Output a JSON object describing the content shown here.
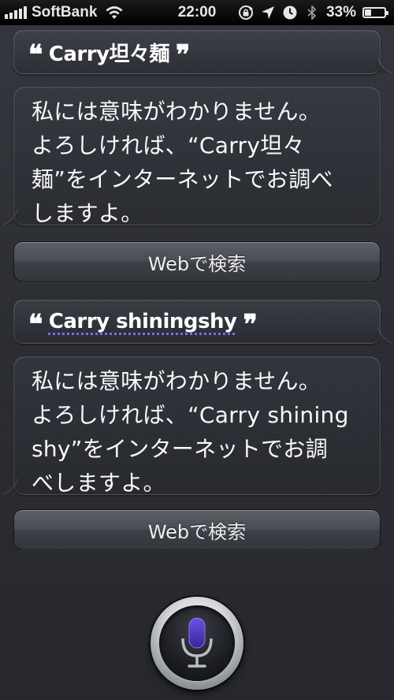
{
  "status_bar": {
    "carrier": "SoftBank",
    "time": "22:00",
    "battery_percent": "33%",
    "battery_level": 0.33,
    "icons": [
      "signal-icon",
      "wifi-icon",
      "rotation-lock-icon",
      "location-icon",
      "alarm-icon",
      "bluetooth-icon",
      "battery-icon"
    ]
  },
  "conversation": [
    {
      "utterance": {
        "open_quote": "❝",
        "text": "Carry坦々麺",
        "close_quote": "❞"
      },
      "response": {
        "lines": [
          "私には意味がわかりません。",
          "よろしければ、“Carry坦々",
          "麺”をインターネットでお調べ",
          "しますよ。"
        ]
      },
      "web_button_label": "Webで検索"
    },
    {
      "utterance": {
        "open_quote": "❝",
        "text": "Carry shiningshy",
        "close_quote": "❞"
      },
      "response": {
        "lines": [
          "私には意味がわかりません。",
          "よろしければ、“Carry shining",
          "shy”をインターネットでお調",
          "べしますよ。"
        ]
      },
      "web_button_label": "Webで検索"
    }
  ],
  "microphone": {
    "icon": "microphone-icon",
    "accent_color": "#5a3fd0"
  }
}
